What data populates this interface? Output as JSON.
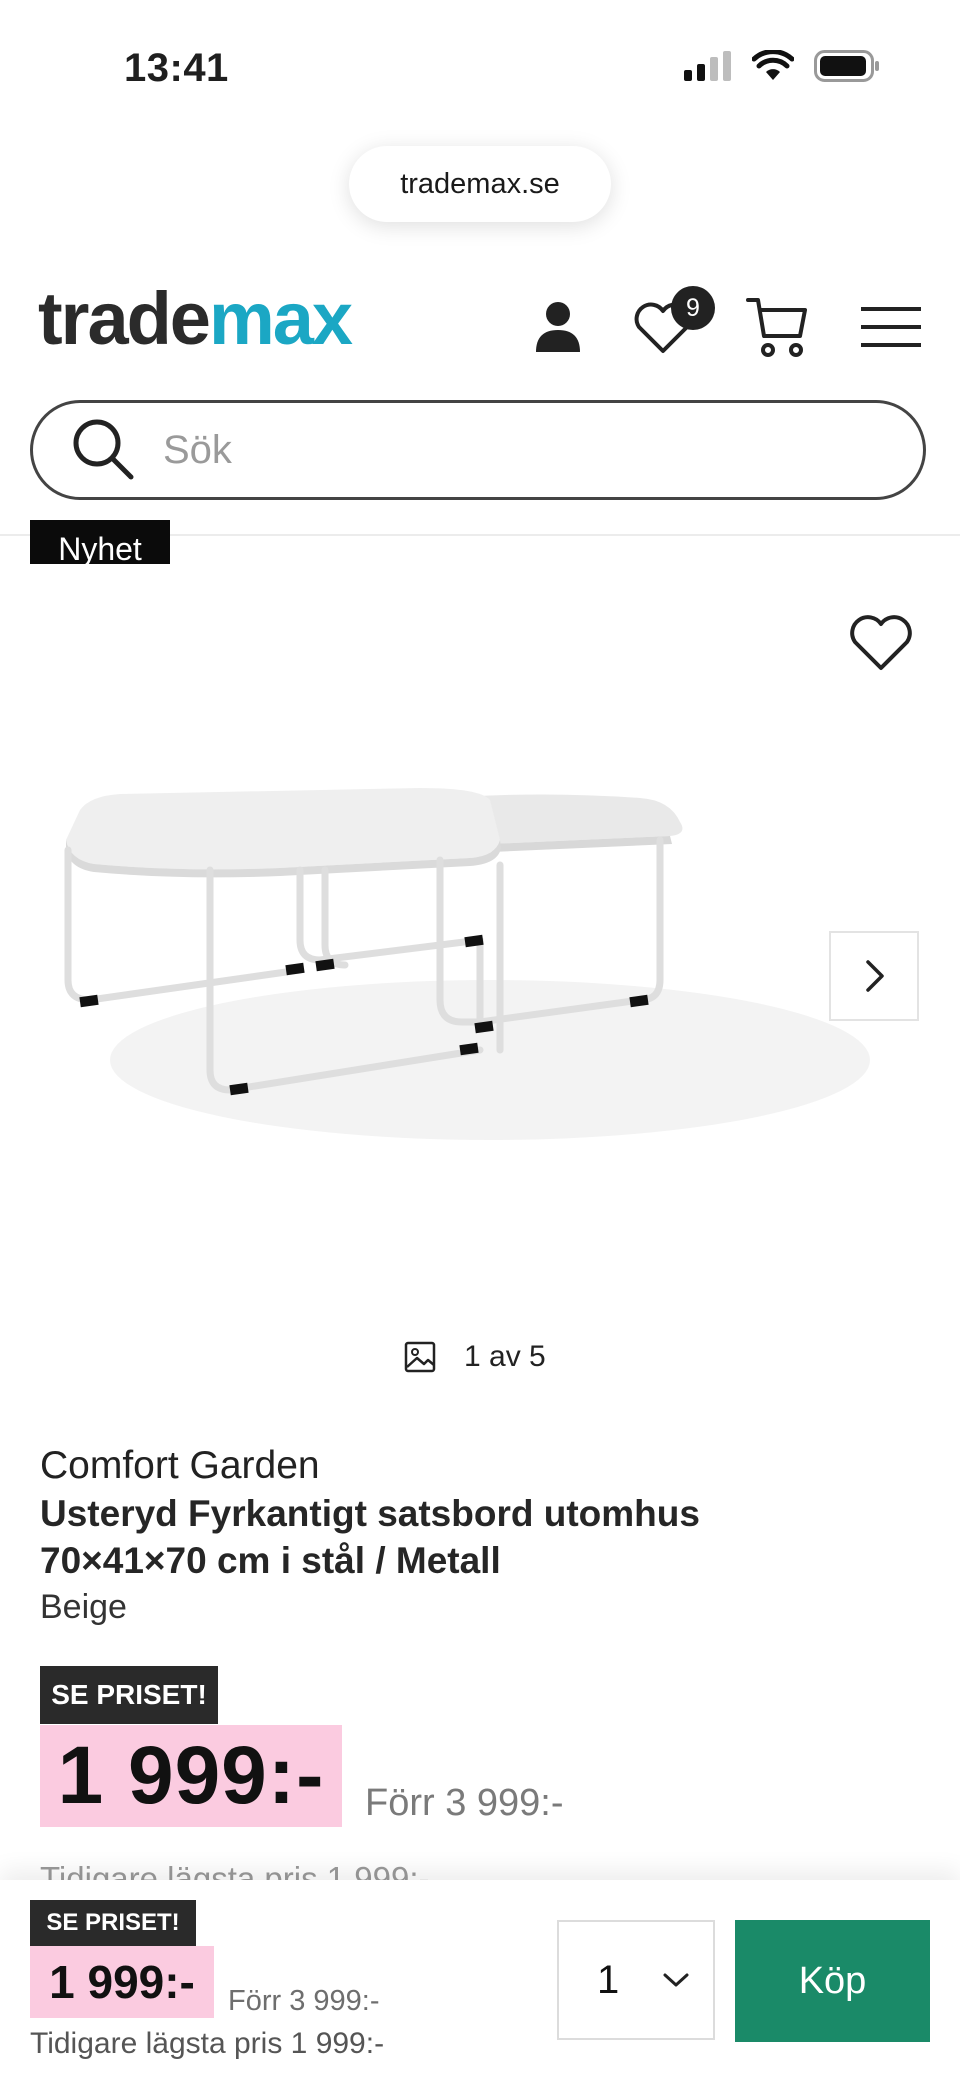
{
  "status_bar": {
    "time": "13:41"
  },
  "browser": {
    "url": "trademax.se"
  },
  "header": {
    "logo_part1": "trade",
    "logo_part2": "max",
    "wishlist_count": "9",
    "search_placeholder": "Sök"
  },
  "product": {
    "badge": "Nyhet",
    "image_counter": "1 av 5",
    "brand": "Comfort Garden",
    "title": "Usteryd Fyrkantigt satsbord utomhus 70×41×70 cm i stål / Metall",
    "color": "Beige",
    "price_tag": "SE PRISET!",
    "price": "1 999:-",
    "was_price": "Förr 3 999:-",
    "lowest_price_partial": "Tidigare lägsta pris 1 999:-"
  },
  "sticky_bar": {
    "price_tag": "SE PRISET!",
    "price": "1 999:-",
    "was_price": "Förr 3 999:-",
    "lowest_price": "Tidigare lägsta pris 1 999:-",
    "quantity": "1",
    "buy_label": "Köp"
  },
  "colors": {
    "brand_dark": "#2b2b2b",
    "brand_accent": "#1ba7c4",
    "price_bg": "#fbcbe0",
    "buy_bg": "#1a8a68"
  },
  "icons": [
    "signal-icon",
    "wifi-icon",
    "battery-icon",
    "user-icon",
    "heart-icon",
    "cart-icon",
    "menu-icon",
    "search-icon",
    "chevron-right-icon",
    "image-icon",
    "chevron-down-icon"
  ]
}
